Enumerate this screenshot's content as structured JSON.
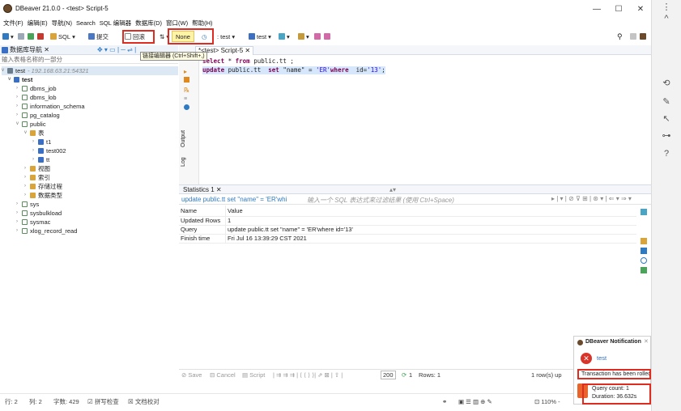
{
  "window": {
    "title": "DBeaver 21.0.0 - <test> Script-5",
    "min_glyph": "—",
    "max_glyph": "☐",
    "close_glyph": "✕"
  },
  "menu": [
    "文件(F)",
    "编辑(E)",
    "导航(N)",
    "Search",
    "SQL 编辑器",
    "数据库(D)",
    "窗口(W)",
    "帮助(H)"
  ],
  "toolbar": {
    "sql_label": "SQL",
    "commit_label": "提交",
    "rollback_label": "回滚",
    "tx_mode_label": "None",
    "connection_label": "test",
    "schema_label": "test",
    "tooltip": "链接编辑器 (Ctrl+Shift+,)"
  },
  "navigator": {
    "tab_label": "数据库导航 ✕",
    "filter_placeholder": "输入表格名称的一部分",
    "connection": {
      "name": "test",
      "host": "- 192.168.63.21:54321"
    },
    "database": "test",
    "schemas_before": [
      "dbms_job",
      "dbms_lob",
      "information_schema",
      "pg_catalog"
    ],
    "public_schema": "public",
    "tables_folder": "表",
    "tables": [
      "t1",
      "test002",
      "tt"
    ],
    "folders": [
      "视图",
      "索引",
      "存储过程",
      "数据类型"
    ],
    "schemas_after": [
      "sys",
      "sysbulkload",
      "sysmac",
      "xlog_record_read"
    ]
  },
  "editor": {
    "tab_label": "*<test> Script-5 ✕",
    "line1_kw1": "select",
    "line1_rest": " * ",
    "line1_kw2": "from",
    "line1_tail": " public.tt ;",
    "line2_kw1": "update",
    "line2_mid1": " public.tt  ",
    "line2_kw2": "set",
    "line2_mid2": " \"name\" = ",
    "line2_str": "'ER'",
    "line2_kw3": "where",
    "line2_mid3": "  id=",
    "line2_str2": "'13'",
    "line2_end": ";",
    "side_tabs": [
      "Output",
      "Log"
    ]
  },
  "results": {
    "tab_label": "Statistics 1 ✕",
    "query_chip": "update public.tt set \"name\" = 'ER'whi",
    "filter_placeholder": "输入一个 SQL 表达式来过滤结果 (使用 Ctrl+Space)",
    "col_name": "Name",
    "col_value": "Value",
    "rows": [
      {
        "name": "Updated Rows",
        "value": "1"
      },
      {
        "name": "Query",
        "value": "update public.tt  set \"name\" = 'ER'where  id='13'"
      },
      {
        "name": "Finish time",
        "value": "Fri Jul 16 13:39:29 CST 2021"
      }
    ],
    "status": {
      "save": "Save",
      "cancel": "Cancel",
      "script": "Script",
      "fetch_size": "200",
      "count": "1",
      "rows_label": "Rows: 1",
      "fetched": "1 row(s) up"
    }
  },
  "notification": {
    "title": "DBeaver Notification",
    "connection": "test",
    "message": "Transaction has been rolled back",
    "query_count": "Query count: 1",
    "duration": "Duration: 36.632s"
  },
  "statusbar": {
    "line": "行: 2",
    "column": "列: 2",
    "chars": "字数: 429",
    "spellcheck": "拼写检查",
    "docproof": "文档校对",
    "zoom": "110%"
  },
  "colors": {
    "accent_red": "#e02b20",
    "tx_yellow": "#fff3a6",
    "keyword": "#7f0055"
  }
}
